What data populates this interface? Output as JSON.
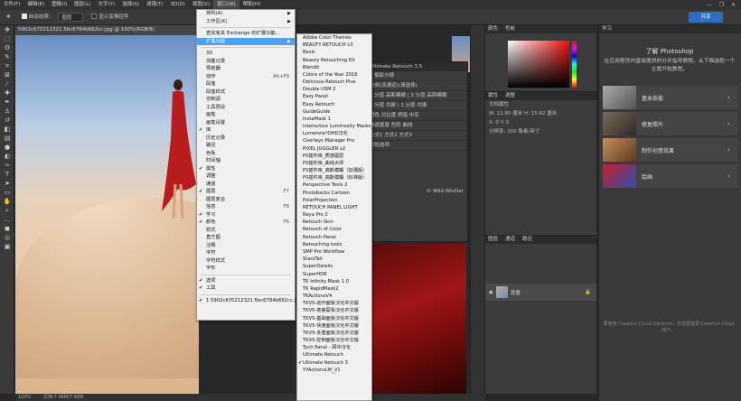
{
  "menubar": {
    "items": [
      "文件(F)",
      "编辑(E)",
      "图像(I)",
      "图层(L)",
      "文字(Y)",
      "选择(S)",
      "滤镜(T)",
      "3D(D)",
      "视图(V)",
      "窗口(W)",
      "帮助(H)"
    ]
  },
  "window_controls": [
    "—",
    "❐",
    "✕"
  ],
  "options_bar": {
    "auto_select_label": "自动选择:",
    "auto_select_value": "图层",
    "transform_label": "显示变换控件"
  },
  "cloud_button": "共享",
  "document": {
    "tab_title": "5902c670212321.5bc6784b662cc.jpg @ 100%(RGB/8)",
    "watermark": "© Wild WinDer"
  },
  "status_bar": {
    "zoom": "100%",
    "doc_size": "文档:7.48M/7.48M"
  },
  "ultimate_retouch_panel": {
    "title": "Ultimate Retouch 3.5",
    "rows": [
      "2 摄影分频",
      "分频(双通道)(请选择)",
      "2 分层 高斯模糊 | 3 分层 高斯模糊",
      "2 分层 共振 | 3 分层 共振",
      "调色  对比度  明暗  中灰",
      "快速蒙版   色阶  曲线",
      "方式1  方式2  方式3",
      "附加选项"
    ]
  },
  "view_menu": {
    "items": [
      {
        "label": "排列(A)",
        "arrow": true
      },
      {
        "label": "工作区(K)",
        "arrow": true
      },
      {
        "sep": true
      },
      {
        "label": "查找有关 Exchange 的扩展功能..."
      },
      {
        "label": "扩展功能",
        "arrow": true,
        "selected": true
      },
      {
        "sep": true
      },
      {
        "label": "3D"
      },
      {
        "label": "测量记录"
      },
      {
        "label": "导航器"
      },
      {
        "label": "动作",
        "shortcut": "Alt+F9"
      },
      {
        "label": "段落"
      },
      {
        "label": "段落样式"
      },
      {
        "label": "仿制源"
      },
      {
        "label": "工具预设"
      },
      {
        "label": "画笔"
      },
      {
        "label": "画笔设置"
      },
      {
        "label": "库",
        "checked": true
      },
      {
        "label": "历史记录"
      },
      {
        "label": "路径"
      },
      {
        "label": "色板"
      },
      {
        "label": "时间轴"
      },
      {
        "label": "属性",
        "checked": true
      },
      {
        "label": "调整"
      },
      {
        "label": "通道"
      },
      {
        "label": "图层",
        "shortcut": "F7",
        "checked": true
      },
      {
        "label": "图层复合"
      },
      {
        "label": "信息",
        "shortcut": "F8"
      },
      {
        "label": "学习",
        "checked": true
      },
      {
        "label": "颜色",
        "shortcut": "F6",
        "checked": true
      },
      {
        "label": "样式"
      },
      {
        "label": "直方图"
      },
      {
        "label": "注释"
      },
      {
        "label": "字符"
      },
      {
        "label": "字符样式"
      },
      {
        "label": "字形"
      },
      {
        "sep": true
      },
      {
        "label": "选项",
        "checked": true
      },
      {
        "label": "工具",
        "checked": true
      },
      {
        "sep": true
      },
      {
        "label": "1 5902c670212321.5bc6784b662cc.jpg",
        "checked": true
      }
    ]
  },
  "extensions_submenu": {
    "items": [
      "Adobe Color Themes",
      "BEAUTY RETOUCH v3",
      "Basic",
      "Beauty Retouching Kit",
      "Blendit",
      "Colors of the Year 2016",
      "Delicious Retouch Plus",
      "Double USM 2",
      "Easy Panel",
      "Easy Retouch",
      "GuideGuide",
      "InstaMask 1",
      "Interactive Luminosity Masks",
      "Lumenzia*OHD汉化",
      "Overlays Manager Pro",
      "PIXEL JUGGLER v2",
      "PS插件库_质感图层",
      "PS插件库_曲线大师",
      "PS插件库_高斯模糊（加强版）",
      "PS插件库_高斯模糊（标准版）",
      "Perspective Tools 2",
      "Photobacks Cartoon",
      "PolarProjection",
      "RETOUCH PANEL LIGHT",
      "Raya Pro 2",
      "Retouch Skin",
      "Retouch of Color",
      "Retouch Panel",
      "Retouching tools",
      "SMP Pro Workflow",
      "StarsTail",
      "SuperDetails",
      "SuperHDR",
      "TK Infinity Mask 1.0",
      "TK RapidMask2",
      "TKActionsV4",
      "TKV5-动作面板汉化中文版",
      "TKV5-亮度蒙板汉化中文版",
      "TKV5-基础面板汉化中文版",
      "TKV5-快速面板汉化中文版",
      "TKV5-多重面板汉化中文版",
      "TKV5-控制面板汉化中文版",
      "Tych Panel - 网中汉化",
      "Ultimate Retouch",
      "Ultimate Retouch 3",
      "YYActionsLM_V1"
    ],
    "checked_index": 44
  },
  "color_panel": {
    "tabs": [
      "颜色",
      "色板"
    ]
  },
  "props_panel": {
    "tabs": [
      "属性",
      "调整"
    ],
    "rows": [
      "文档属性",
      "W: 11.85 厘米  H: 15.62 厘米",
      "X: 0   Y: 0",
      "分辨率: 300 像素/英寸"
    ]
  },
  "layers_panel": {
    "tabs": [
      "图层",
      "通道",
      "路径"
    ],
    "layer_name": "背景"
  },
  "learn_panel": {
    "tab": "学习",
    "title": "了解 Photoshop",
    "description": "在应用程序内直接提供的分步指导教程。从下面选取一个主题开始教程。",
    "cards": [
      "基本技能",
      "修复照片",
      "制作创意效果",
      "绘画"
    ]
  },
  "cc_libraries_text": "要使用 Creative Cloud Libraries，你需要登录 Creative Cloud 帐户。"
}
